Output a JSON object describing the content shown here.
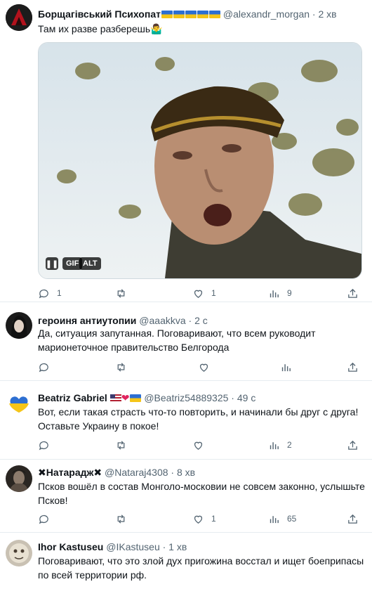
{
  "tweets": [
    {
      "name": "Борщагівський Психопат",
      "handle": "@alexandr_morgan · 2 хв",
      "text": "Там их разве разберешь🤷‍♂️",
      "media": {
        "gif_label": "GIF",
        "alt_label": "ALT"
      },
      "replies": "1",
      "retweets": "",
      "likes": "1",
      "views": "9"
    },
    {
      "name": "героиня антиутопии",
      "handle": "@aaakkva · 2 с",
      "text": "Да, ситуация запутанная. Поговаривают, что всем руководит марионеточное правительство Белгорода",
      "replies": "",
      "retweets": "",
      "likes": "",
      "views": ""
    },
    {
      "name": "Beatriz Gabriel",
      "handle": "@Beatriz54889325 · 49 с",
      "text": "Вот, если такая страсть что-то повторить, и начинали бы друг с друга! Оставьте Украину в покое!",
      "replies": "",
      "retweets": "",
      "likes": "",
      "views": "2"
    },
    {
      "name": "✖Натарадж✖",
      "handle": "@Nataraj4308 · 8 хв",
      "text": "Псков вошёл в состав Монголо-московии не совсем законно, услышьте Псков!",
      "replies": "",
      "retweets": "",
      "likes": "1",
      "views": "65"
    },
    {
      "name": "Ihor Kastuseu",
      "handle": "@IKastuseu · 1 хв",
      "text": "Поговаривают, что это злой дух пригожина восстал и ищет боеприпасы по всей территории рф."
    }
  ],
  "colors": {
    "text": "#0f1419",
    "secondary": "#536471",
    "divider": "#e6ecf0",
    "heart": "#e0245e"
  }
}
